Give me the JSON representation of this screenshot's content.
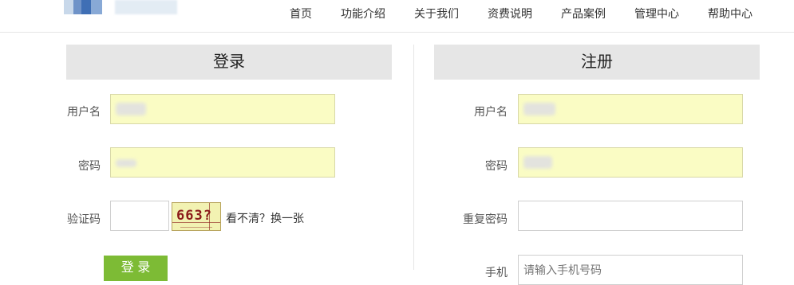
{
  "nav": [
    "首页",
    "功能介绍",
    "关于我们",
    "资费说明",
    "产品案例",
    "管理中心",
    "帮助中心"
  ],
  "login": {
    "title": "登录",
    "username_label": "用户名",
    "password_label": "密码",
    "captcha_label": "验证码",
    "captcha_text": "663?",
    "captcha_refresh": "看不清？换一张",
    "submit_label": "登 录"
  },
  "register": {
    "title": "注册",
    "username_label": "用户名",
    "password_label": "密码",
    "repeat_password_label": "重复密码",
    "phone_label": "手机",
    "phone_placeholder": "请输入手机号码"
  },
  "colors": {
    "autofill": "#fafcc4",
    "button": "#7dbb35",
    "panel_header": "#e6e6e6"
  }
}
